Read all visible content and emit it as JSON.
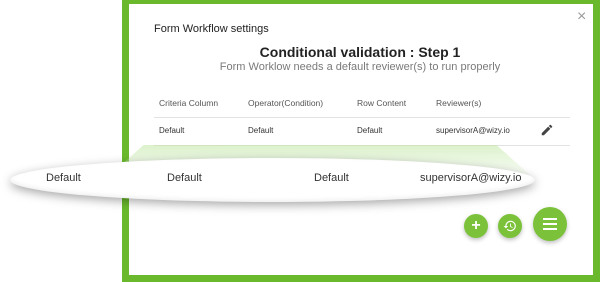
{
  "dialog": {
    "title": "Form Workflow settings",
    "close_label": "×",
    "heading": "Conditional validation : Step 1",
    "subheading": "Form Worklow needs a default reviewer(s) to run properly"
  },
  "table": {
    "columns": [
      "Criteria Column",
      "Operator(Condition)",
      "Row Content",
      "Reviewer(s)"
    ],
    "rows": [
      [
        "Default",
        "Default",
        "Default",
        "supervisorA@wizy.io"
      ]
    ]
  },
  "zoomed_row": [
    "Default",
    "Default",
    "Default",
    "supervisorA@wizy.io"
  ],
  "buttons": {
    "add_label": "+"
  },
  "icons": {
    "edit": "pencil-icon",
    "restore": "restore-icon",
    "menu": "menu-icon",
    "close": "close-icon"
  },
  "colors": {
    "accent": "#6ab92c",
    "fab": "#7bc23a"
  }
}
